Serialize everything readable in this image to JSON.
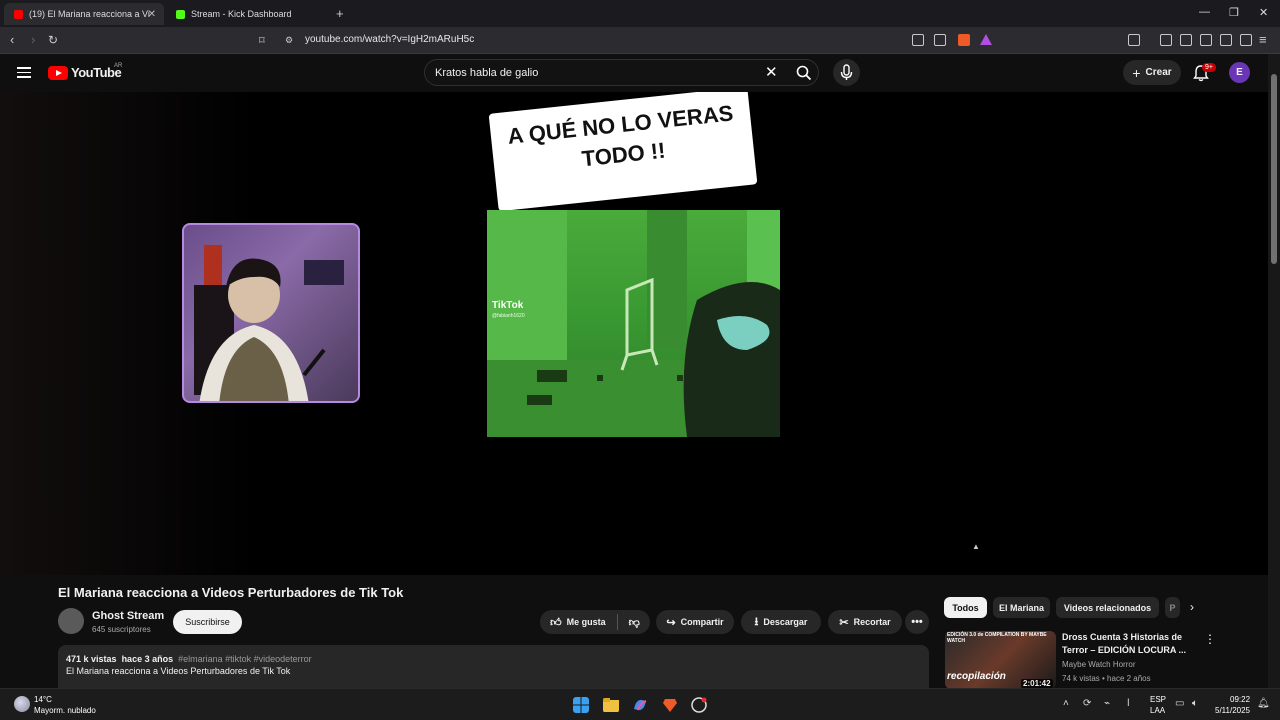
{
  "browser": {
    "tabs": [
      {
        "label": "(19) El Mariana reacciona a Vi",
        "active": true,
        "favicon_color": "#ff0000"
      },
      {
        "label": "Stream - Kick Dashboard",
        "active": false,
        "favicon_color": "#53fc18"
      }
    ],
    "url": "youtube.com/watch?v=IgH2mARuH5c"
  },
  "youtube_header": {
    "logo_text": "YouTube",
    "country_code": "AR",
    "search_value": "Kratos habla de galio",
    "create_label": "Crear",
    "notification_count": "9+",
    "avatar_letter": "E"
  },
  "player": {
    "overlay_banner": "A QUÉ NO LO VERAS TODO !!",
    "tiktok_mark": "TikTok",
    "tiktok_handle": "@fabianh1620"
  },
  "video": {
    "title": "El Mariana reacciona a Videos Perturbadores de Tik Tok",
    "channel_name": "Ghost Stream",
    "subscribers": "645 suscriptores",
    "subscribe_label": "Suscribirse",
    "actions": {
      "like": "Me gusta",
      "share": "Compartir",
      "download": "Descargar",
      "clip": "Recortar"
    },
    "views": "471 k vistas",
    "age": "hace 3 años",
    "hashtags": "#elmariana #tiktok #videodeterror",
    "description": "El Mariana reacciona a Videos Perturbadores de Tik Tok"
  },
  "sidebar": {
    "chips": [
      "Todos",
      "El Mariana",
      "Videos relacionados",
      "P"
    ],
    "recommendation": {
      "thumb_label": "EDICIÓN 3.0 de COMPILATION BY MAYBE WATCH",
      "thumb_word": "recopilación",
      "duration": "2:01:42",
      "title": "Dross Cuenta 3 Historias de Terror – EDICIÓN LOCURA ...",
      "channel": "Maybe Watch Horror",
      "meta": "74 k vistas • hace 2 años"
    }
  },
  "taskbar": {
    "temperature": "14°C",
    "weather": "Mayorm. nublado",
    "lang_top": "ESP",
    "lang_bottom": "LAA",
    "time": "09:22",
    "date": "5/11/2025"
  },
  "colors": {
    "accent_red": "#ff0000",
    "avatar_purple": "#6a36b8",
    "background": "#0f0f0f"
  }
}
